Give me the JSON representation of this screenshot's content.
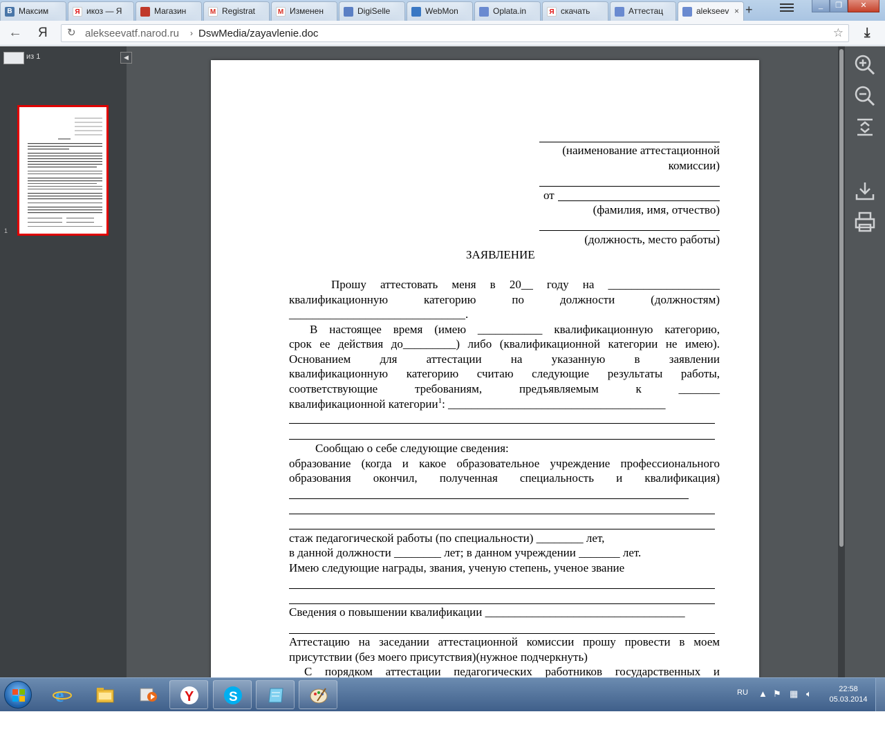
{
  "tabs": [
    {
      "title": "Максим",
      "favicon": "vk-icon",
      "letter": "В",
      "color": "#4a76a8"
    },
    {
      "title": "икоз — Я",
      "favicon": "yandex-icon",
      "letter": "Я",
      "color": "#ffffff"
    },
    {
      "title": "Магазин",
      "favicon": "shop-icon",
      "letter": "",
      "color": "#c0392b"
    },
    {
      "title": "Registrat",
      "favicon": "gmail-icon",
      "letter": "M",
      "color": "#ffffff"
    },
    {
      "title": "Изменен",
      "favicon": "gmail-icon",
      "letter": "M",
      "color": "#ffffff"
    },
    {
      "title": "DigiSelle",
      "favicon": "digiseller-icon",
      "letter": "",
      "color": "#5b7fc4"
    },
    {
      "title": "WebMon",
      "favicon": "webmoney-icon",
      "letter": "",
      "color": "#3a78c4"
    },
    {
      "title": "Oplata.in",
      "favicon": "oplata-icon",
      "letter": "",
      "color": "#6a8ad0"
    },
    {
      "title": "скачать",
      "favicon": "yandex-icon",
      "letter": "Я",
      "color": "#ffffff"
    },
    {
      "title": "Аттестац",
      "favicon": "narod-icon",
      "letter": "",
      "color": "#6a8ad0"
    },
    {
      "title": "alekseev",
      "favicon": "narod-icon",
      "letter": "",
      "color": "#6a8ad0",
      "active": true
    }
  ],
  "address": {
    "host": "alekseevatf.narod.ru",
    "separator": "›",
    "path": "DswMedia/zayavlenie.doc"
  },
  "viewer": {
    "page_input": "",
    "page_of": "из 1",
    "thumb_number": "1"
  },
  "document": {
    "commission_label_1": "(наименование аттестационной",
    "commission_label_2": "комиссии)",
    "from_label": "от",
    "fio_label": "(фамилия, имя, отчество)",
    "position_label": "(должность, место работы)",
    "title": "ЗАЯВЛЕНИЕ",
    "p1_l1": "Прошу аттестовать меня в 20__ году на ___________________",
    "p1_l2": "квалификационную категорию по должности (должностям)",
    "p1_l3": "______________________________.",
    "p2_l1": "В настоящее время (имею ___________ квалификационную категорию,",
    "p2_l2": "срок ее действия до_________) либо (квалификационной категории не имею).",
    "p2_l3": "Основанием для аттестации на указанную в заявлении",
    "p2_l4": "квалификационную категорию считаю следующие результаты работы,",
    "p2_l5": "соответствующие требованиям, предъявляемым к _______",
    "p2_l6a": "квалификационной категории",
    "p2_l6sup": "1",
    "p2_l6b": ": _____________________________________",
    "p3_l1": "Сообщаю о себе следующие сведения:",
    "p3_l2": "образование (когда и какое образовательное учреждение профессионального",
    "p3_l3": "образования окончил, полученная специальность и квалификация)",
    "p4_l1": "стаж педагогической работы (по специальности) ________ лет,",
    "p4_l2": "в данной должности ________ лет; в данном учреждении _______ лет.",
    "p4_l3": "Имею следующие награды, звания, ученую степень, ученое звание",
    "p5_l1": "Сведения о повышении квалификации __________________________________",
    "p6_l1": "Аттестацию на заседании аттестационной комиссии прошу провести в моем",
    "p6_l2": "присутствии (без моего присутствия)(нужное подчеркнуть)",
    "p7_l1": "С порядком аттестации педагогических работников государственных и"
  },
  "taskbar": {
    "language": "RU",
    "time": "22:58",
    "date": "05.03.2014"
  }
}
